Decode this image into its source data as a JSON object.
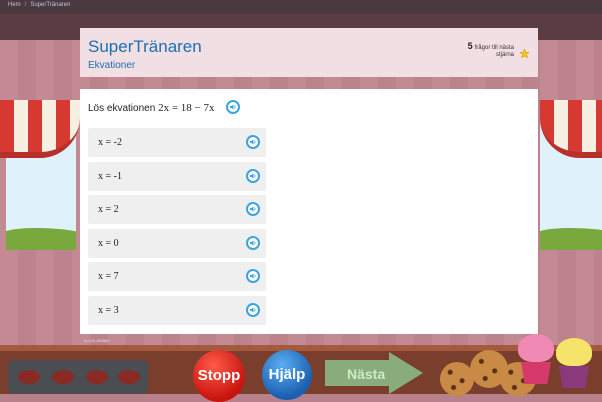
{
  "breadcrumb": {
    "home": "Hem",
    "current": "SuperTränaren"
  },
  "header": {
    "title": "SuperTränaren",
    "subtitle": "Ekvationer",
    "score_count": "5",
    "score_text_line1": "frågor till nästa",
    "score_text_line2": "stjärna"
  },
  "question": {
    "prompt_text": "Lös ekvationen",
    "equation": "2x = 18 − 7x",
    "answers": [
      {
        "label": "x = -2"
      },
      {
        "label": "x = -1"
      },
      {
        "label": "x = 2"
      },
      {
        "label": "x = 0"
      },
      {
        "label": "x = 7"
      },
      {
        "label": "x = 3"
      }
    ],
    "card_id": "N-429-369880"
  },
  "buttons": {
    "stop": "Stopp",
    "help": "Hjälp",
    "next": "Nästa"
  },
  "colors": {
    "accent": "#1b6fb3",
    "audio": "#3aa3e0",
    "stop": "#d8201a",
    "help": "#2a7bd0",
    "next": "#8bc08a"
  },
  "icons": {
    "audio": "speaker-icon",
    "star": "star-icon"
  }
}
